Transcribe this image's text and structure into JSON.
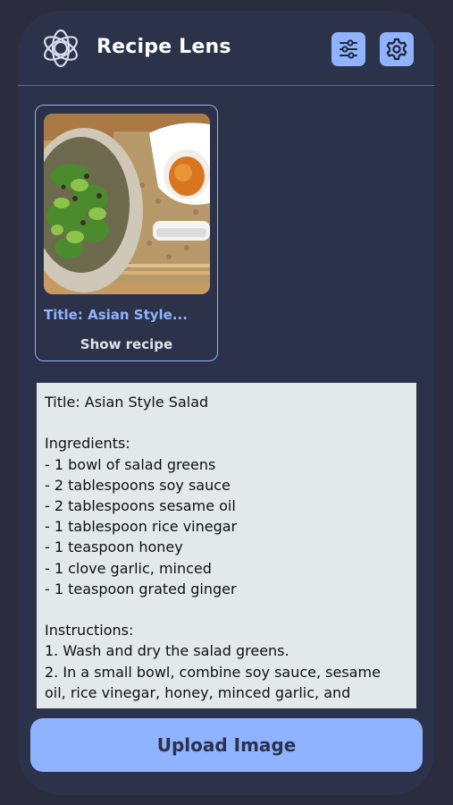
{
  "header": {
    "logo_icon": "openai-knot-icon",
    "app_title": "Recipe Lens",
    "filter_icon": "sliders-icon",
    "settings_icon": "gear-icon"
  },
  "card": {
    "image_desc": "salad-plate-photo",
    "title": "Title: Asian Style...",
    "show_recipe_label": "Show recipe"
  },
  "recipe": {
    "lines": [
      "Title: Asian Style Salad",
      "",
      "Ingredients:",
      "- 1 bowl of salad greens",
      "- 2 tablespoons soy sauce",
      "- 2 tablespoons sesame oil",
      "- 1 tablespoon rice vinegar",
      "- 1 teaspoon honey",
      "- 1 clove garlic, minced",
      "- 1 teaspoon grated ginger",
      "",
      "Instructions:",
      "1. Wash and dry the salad greens.",
      "2. In a small bowl, combine soy sauce, sesame",
      "oil, rice vinegar, honey, minced garlic, and"
    ]
  },
  "upload_button": {
    "label": "Upload Image"
  },
  "colors": {
    "background": "#2b3249",
    "accent": "#8fb3ff",
    "recipe_panel": "#e3e8ea"
  }
}
